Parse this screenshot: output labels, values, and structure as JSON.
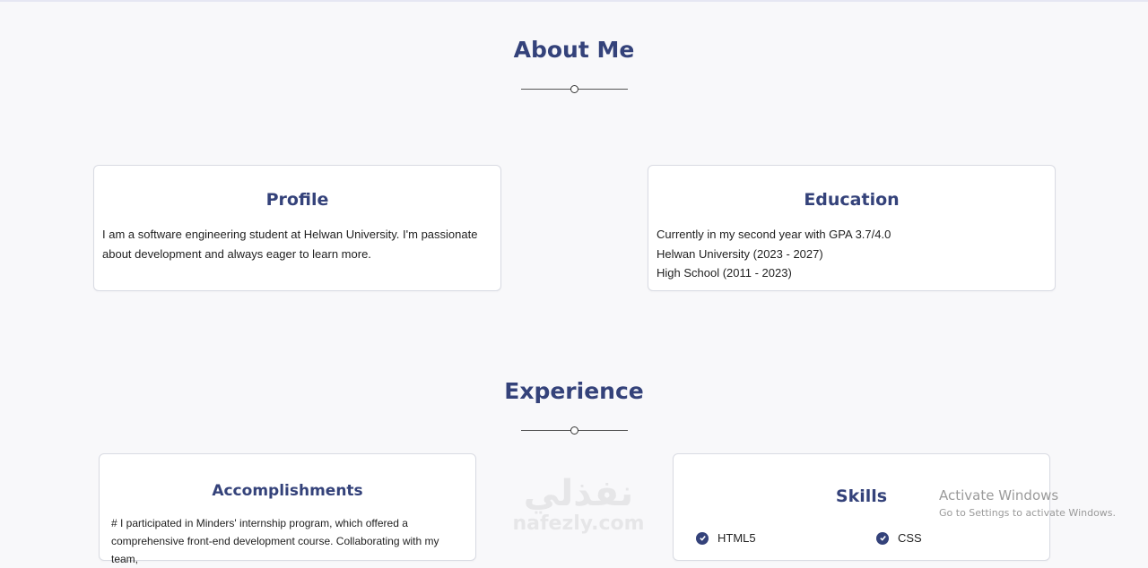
{
  "about": {
    "title": "About Me",
    "profile": {
      "title": "Profile",
      "text": "I am a software engineering student at Helwan University. I'm passionate about development and always eager to learn more."
    },
    "education": {
      "title": "Education",
      "lines": [
        "Currently in my second year with GPA 3.7/4.0",
        "Helwan University (2023 - 2027)",
        "High School (2011 - 2023)"
      ]
    }
  },
  "experience": {
    "title": "Experience",
    "accomplishments": {
      "title": "Accomplishments",
      "text": "# I participated in Minders' internship program, which offered a comprehensive front-end development course. Collaborating with my team,"
    },
    "skills": {
      "title": "Skills",
      "items": [
        "HTML5",
        "CSS"
      ]
    }
  },
  "watermark": {
    "arabic": "نفذلي",
    "latin": "nafezly.com"
  },
  "activation": {
    "title": "Activate Windows",
    "subtitle": "Go to Settings to activate Windows."
  },
  "colors": {
    "heading": "#34427a",
    "background": "#f8f8fa",
    "card": "#ffffff"
  }
}
